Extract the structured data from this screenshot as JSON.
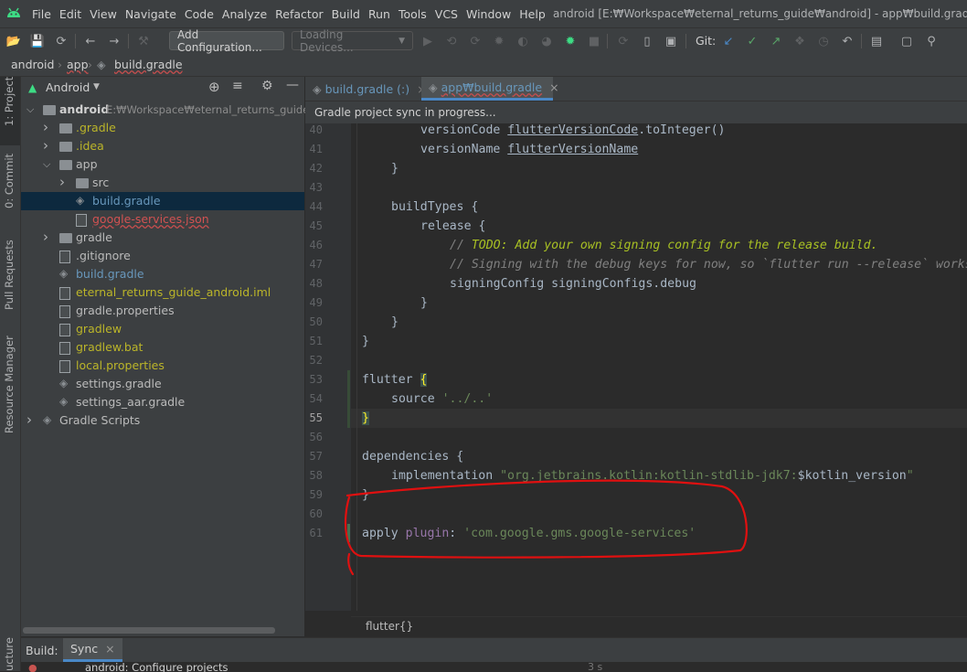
{
  "menubar": {
    "items": [
      "File",
      "Edit",
      "View",
      "Navigate",
      "Code",
      "Analyze",
      "Refactor",
      "Build",
      "Run",
      "Tools",
      "VCS",
      "Window",
      "Help"
    ],
    "window_title": "android [E:₩Workspace₩eternal_returns_guide₩android] - app₩build.gradle"
  },
  "toolbar": {
    "add_configuration": "Add Configuration...",
    "loading_devices": "Loading Devices...",
    "git_label": "Git:"
  },
  "breadcrumb": [
    "android",
    "app",
    "build.gradle"
  ],
  "sidebar_tabs": [
    "1: Project",
    "0: Commit",
    "Pull Requests",
    "Resource Manager",
    "ucture"
  ],
  "project": {
    "view": "Android",
    "root": {
      "label": "android",
      "path": "E:₩Workspace₩eternal_returns_guide₩ar"
    },
    "items": [
      {
        "label": ".gradle",
        "color": "#bbb529"
      },
      {
        "label": ".idea",
        "color": "#bbb529"
      },
      {
        "label": "app",
        "color": "#bbbbbb"
      },
      {
        "label": "src",
        "color": "#bbbbbb"
      },
      {
        "label": "build.gradle",
        "color": "#6897bb"
      },
      {
        "label": "google-services.json",
        "color": "#d25252"
      },
      {
        "label": "gradle",
        "color": "#bbbbbb"
      },
      {
        "label": ".gitignore",
        "color": "#bbbbbb"
      },
      {
        "label": "build.gradle",
        "color": "#6897bb"
      },
      {
        "label": "eternal_returns_guide_android.iml",
        "color": "#bbb529"
      },
      {
        "label": "gradle.properties",
        "color": "#bbbbbb"
      },
      {
        "label": "gradlew",
        "color": "#bbb529"
      },
      {
        "label": "gradlew.bat",
        "color": "#bbb529"
      },
      {
        "label": "local.properties",
        "color": "#bbb529"
      },
      {
        "label": "settings.gradle",
        "color": "#bbbbbb"
      },
      {
        "label": "settings_aar.gradle",
        "color": "#bbbbbb"
      },
      {
        "label": "Gradle Scripts",
        "color": "#bbbbbb"
      }
    ]
  },
  "editor": {
    "tabs": [
      {
        "label": "build.gradle (:)",
        "active": false
      },
      {
        "label": "app₩build.gradle",
        "active": true
      }
    ],
    "sync_message": "Gradle project sync in progress...",
    "line_numbers": [
      "40",
      "41",
      "42",
      "43",
      "44",
      "45",
      "46",
      "47",
      "48",
      "49",
      "50",
      "51",
      "52",
      "53",
      "54",
      "55",
      "56",
      "57",
      "58",
      "59",
      "60",
      "61"
    ],
    "current_line": "55",
    "code": {
      "l40a": "versionCode ",
      "l40b": "flutterVersionCode",
      "l40c": ".toInteger()",
      "l41a": "versionName ",
      "l41b": "flutterVersionName",
      "l42": "}",
      "l44": "buildTypes {",
      "l45": "release {",
      "l46a": "// ",
      "l46b": "TODO: Add your own signing config for the release build.",
      "l47": "// Signing with the debug keys for now, so `flutter run --release` works.",
      "l48": "signingConfig signingConfigs.debug",
      "l49": "}",
      "l50": "}",
      "l51": "}",
      "l53a": "flutter ",
      "l53b": "{",
      "l54a": "source ",
      "l54b": "'../..'",
      "l55": "}",
      "l57": "dependencies {",
      "l58a": "implementation ",
      "l58b": "\"org.jetbrains.kotlin:kotlin-stdlib-jdk7:",
      "l58c": "$kotlin_version",
      "l58d": "\"",
      "l59": "}",
      "l61a": "apply ",
      "l61b": "plugin",
      "l61c": ": ",
      "l61d": "'com.google.gms.google-services'"
    },
    "structure_crumb": "flutter{}"
  },
  "bottom": {
    "build_label": "Build:",
    "sync_tab": "Sync",
    "task_label": "android: Configure projects",
    "task_time": "3 s"
  },
  "colors": {
    "annotation": "#e01010",
    "accent": "#4a88c7",
    "android_green": "#3ddc84"
  }
}
